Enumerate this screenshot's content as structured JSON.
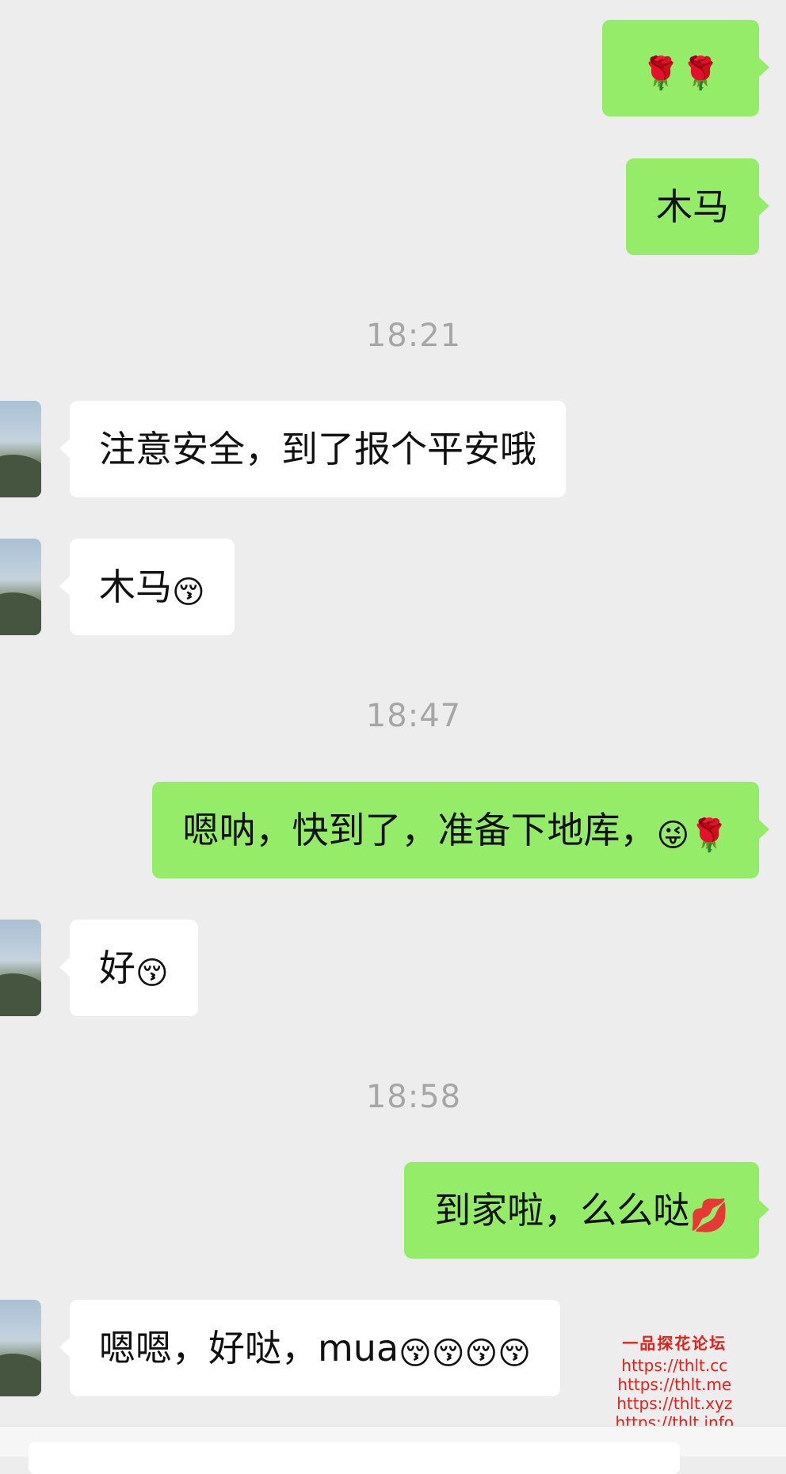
{
  "messages": [
    {
      "side": "out",
      "text": "",
      "emoji": "🌹🌹"
    },
    {
      "side": "out",
      "text": "木马",
      "emoji": ""
    },
    {
      "timestamp": "18:21"
    },
    {
      "side": "in",
      "text": "注意安全，到了报个平安哦",
      "emoji": ""
    },
    {
      "side": "in",
      "text": "木马",
      "emoji": "😚"
    },
    {
      "timestamp": "18:47"
    },
    {
      "side": "out",
      "text": "嗯呐，快到了，准备下地库，",
      "emoji": "😜🌹"
    },
    {
      "side": "in",
      "text": "好",
      "emoji": "😚"
    },
    {
      "timestamp": "18:58"
    },
    {
      "side": "out",
      "text": "到家啦，么么哒",
      "emoji": "💋"
    },
    {
      "side": "in",
      "text": "嗯嗯，好哒，mua",
      "emoji": "😚😚😚😚"
    }
  ],
  "watermark": {
    "title": "一品探花论坛",
    "urls": [
      "https://thlt.cc",
      "https://thlt.me",
      "https://thlt.xyz",
      "https://thlt.info"
    ]
  },
  "colors": {
    "background": "#ededed",
    "outgoing_bubble": "#95ec69",
    "incoming_bubble": "#ffffff",
    "timestamp_text": "#a6a6a6",
    "watermark_text": "#e0221a"
  }
}
